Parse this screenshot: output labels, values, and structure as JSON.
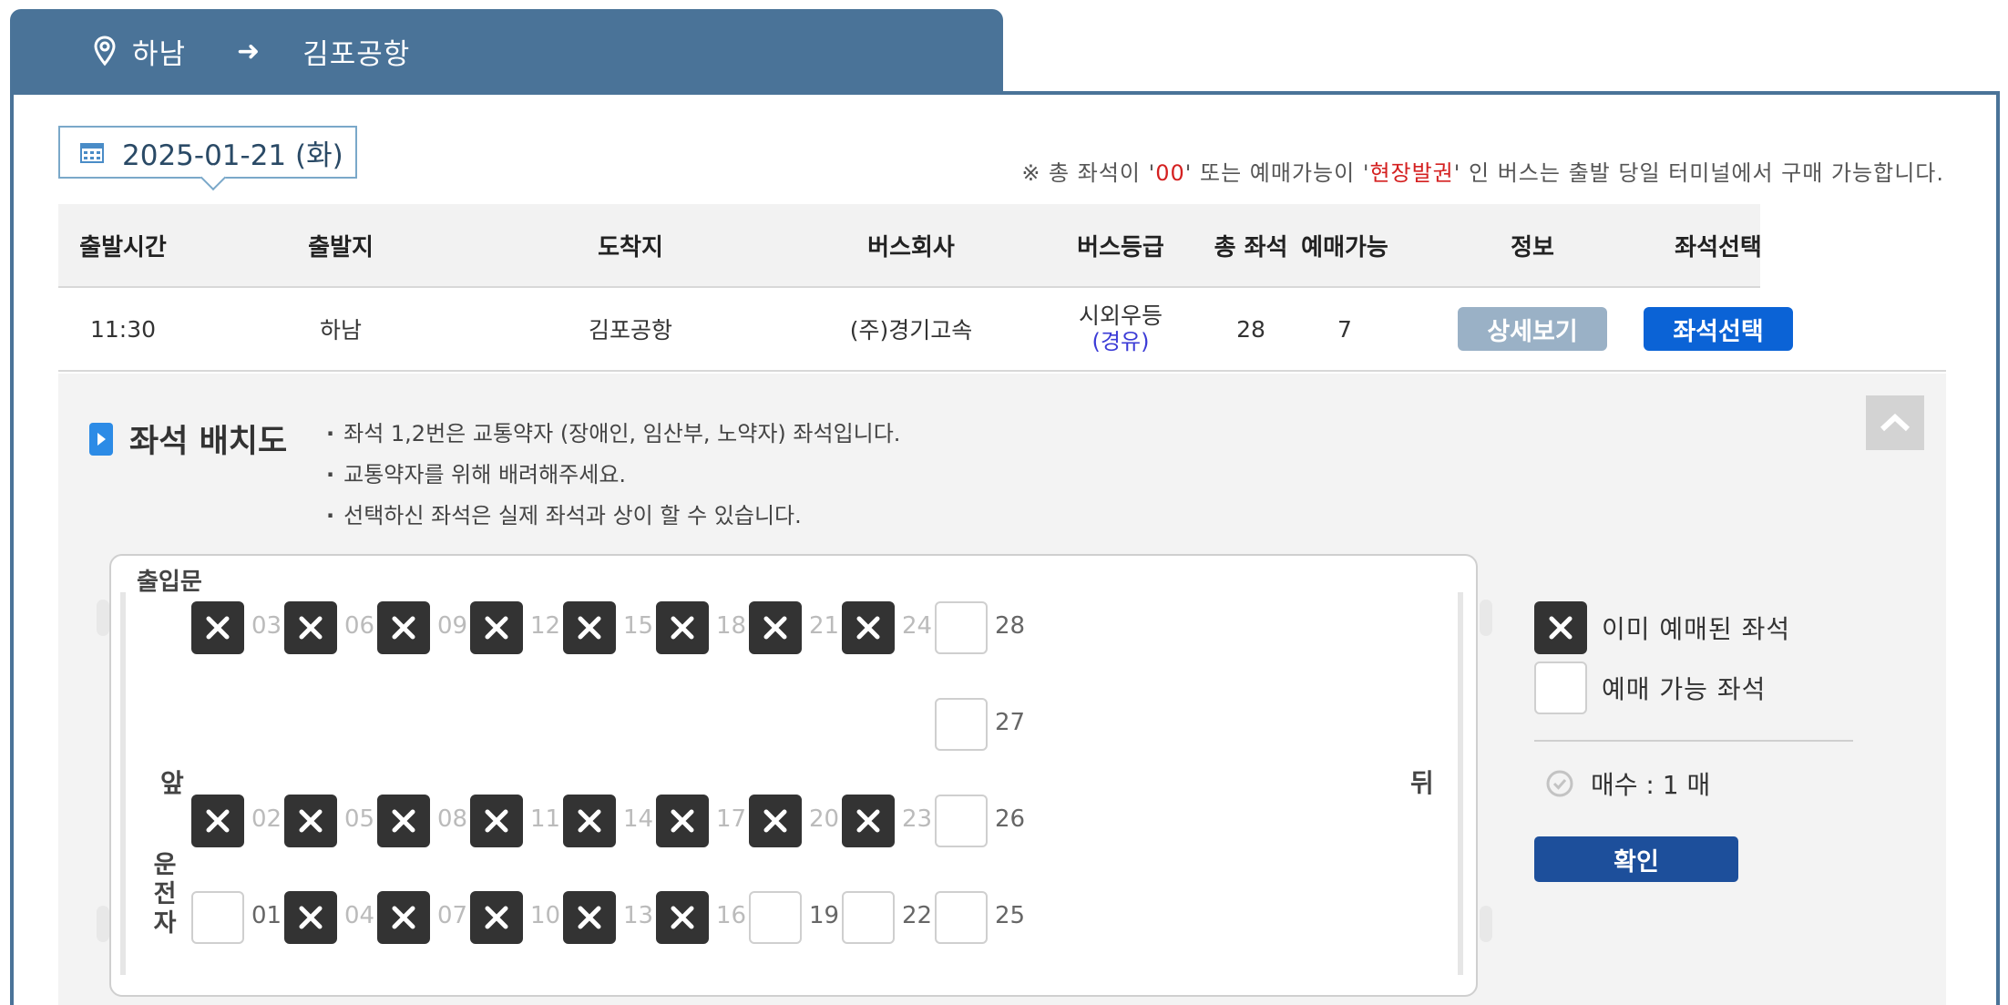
{
  "route": {
    "origin": "하남",
    "destination": "김포공항"
  },
  "date": {
    "value": "2025-01-21 (화)"
  },
  "notice": {
    "prefix": "※ 총 좌석이 '",
    "highlight1": "00",
    "middle": "' 또는 예매가능이 '",
    "highlight2": "현장발권",
    "suffix": "' 인 버스는 출발 당일 터미널에서 구매 가능합니다.",
    "highlight_color": "#d42020"
  },
  "table": {
    "headers": {
      "departure_time": "출발시간",
      "origin": "출발지",
      "destination": "도착지",
      "company": "버스회사",
      "grade": "버스등급",
      "total_seats": "총 좌석",
      "available": "예매가능",
      "info": "정보",
      "seat_select": "좌석선택"
    },
    "row": {
      "departure_time": "11:30",
      "origin": "하남",
      "destination": "김포공항",
      "company": "(주)경기고속",
      "grade": "시외우등",
      "grade_note": "(경유)",
      "total_seats": "28",
      "available": "7",
      "detail_button": "상세보기",
      "select_button": "좌석선택"
    }
  },
  "seat_map": {
    "title": "좌석 배치도",
    "notes": [
      "좌석 1,2번은 교통약자 (장애인, 임산부, 노약자) 좌석입니다.",
      "교통약자를 위해 배려해주세요.",
      "선택하신 좌석은 실제 좌석과 상이 할 수 있습니다."
    ],
    "door_label": "출입문",
    "front_label": "앞",
    "back_label": "뒤",
    "driver_label": "운전자",
    "seats": [
      {
        "no": "03",
        "status": "sold"
      },
      {
        "no": "06",
        "status": "sold"
      },
      {
        "no": "09",
        "status": "sold"
      },
      {
        "no": "12",
        "status": "sold"
      },
      {
        "no": "15",
        "status": "sold"
      },
      {
        "no": "18",
        "status": "sold"
      },
      {
        "no": "21",
        "status": "sold"
      },
      {
        "no": "24",
        "status": "sold"
      },
      {
        "no": "28",
        "status": "available"
      },
      {
        "no": "27",
        "status": "available"
      },
      {
        "no": "02",
        "status": "sold"
      },
      {
        "no": "05",
        "status": "sold"
      },
      {
        "no": "08",
        "status": "sold"
      },
      {
        "no": "11",
        "status": "sold"
      },
      {
        "no": "14",
        "status": "sold"
      },
      {
        "no": "17",
        "status": "sold"
      },
      {
        "no": "20",
        "status": "sold"
      },
      {
        "no": "23",
        "status": "sold"
      },
      {
        "no": "26",
        "status": "available"
      },
      {
        "no": "01",
        "status": "available"
      },
      {
        "no": "04",
        "status": "sold"
      },
      {
        "no": "07",
        "status": "sold"
      },
      {
        "no": "10",
        "status": "sold"
      },
      {
        "no": "13",
        "status": "sold"
      },
      {
        "no": "16",
        "status": "sold"
      },
      {
        "no": "19",
        "status": "available"
      },
      {
        "no": "22",
        "status": "available"
      },
      {
        "no": "25",
        "status": "available"
      }
    ]
  },
  "legend": {
    "sold": "이미 예매된 좌석",
    "available": "예매 가능 좌석",
    "count": "매수 : 1 매",
    "confirm_button": "확인"
  },
  "colors": {
    "header_bg": "#4a7398",
    "select_button": "#0b63d6",
    "detail_button": "#9ab1c6",
    "confirm_button": "#1d4f9b",
    "sold_seat": "#333333"
  }
}
